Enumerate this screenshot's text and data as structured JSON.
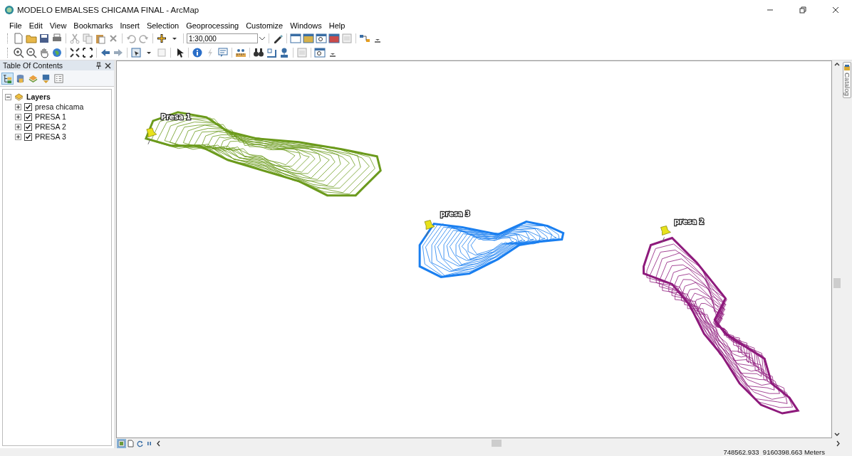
{
  "window": {
    "title": "MODELO EMBALSES CHICAMA FINAL - ArcMap"
  },
  "menu": [
    "File",
    "Edit",
    "View",
    "Bookmarks",
    "Insert",
    "Selection",
    "Geoprocessing",
    "Customize",
    "Windows",
    "Help"
  ],
  "toolbar": {
    "scale": "1:30,000"
  },
  "toc": {
    "title": "Table Of Contents",
    "layers": [
      {
        "label": "Layers",
        "expanded": true,
        "children": [
          {
            "label": "presa chicama",
            "checked": true,
            "expanded": false
          },
          {
            "label": "PRESA 1",
            "checked": true,
            "expanded": false
          },
          {
            "label": "PRESA 2",
            "checked": true,
            "expanded": false
          },
          {
            "label": "PRESA 3",
            "checked": true,
            "expanded": false
          }
        ]
      }
    ]
  },
  "map": {
    "features": [
      {
        "kind": "reservoir1",
        "label": "Presa 1",
        "color": "#6b9a1c"
      },
      {
        "kind": "reservoir3",
        "label": "presa 3",
        "color": "#1a7ff0"
      },
      {
        "kind": "reservoir2",
        "label": "presa 2",
        "color": "#8e1a7c"
      }
    ]
  },
  "catalog_tab": "Catalog",
  "status_bar": {
    "coordinates": "748562.933  9160398.663 Meters"
  }
}
